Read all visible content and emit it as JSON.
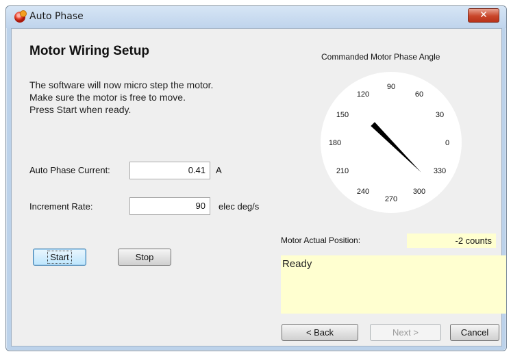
{
  "window": {
    "title": "Auto Phase",
    "close_label": "✕"
  },
  "heading": "Motor Wiring Setup",
  "instructions": [
    "The software will now micro step the motor.",
    "Make sure the motor is free to move.",
    "Press Start when ready."
  ],
  "current": {
    "label": "Auto Phase Current:",
    "value": "0.41",
    "unit": "A"
  },
  "increment": {
    "label": "Increment Rate:",
    "value": "90",
    "unit": "elec deg/s"
  },
  "buttons": {
    "start": "Start",
    "stop": "Stop",
    "back": "< Back",
    "next": "Next >",
    "cancel": "Cancel"
  },
  "dial": {
    "title": "Commanded Motor Phase Angle",
    "ticks": [
      "0",
      "30",
      "60",
      "90",
      "120",
      "150",
      "180",
      "210",
      "240",
      "270",
      "300",
      "330"
    ],
    "needle_angle_deg": 315
  },
  "position": {
    "label": "Motor Actual Position:",
    "value": "-2 counts"
  },
  "status": "Ready",
  "colors": {
    "titlebar": "#c4d8ee",
    "field_highlight": "#ffffd0",
    "close_button": "#c9462a"
  }
}
